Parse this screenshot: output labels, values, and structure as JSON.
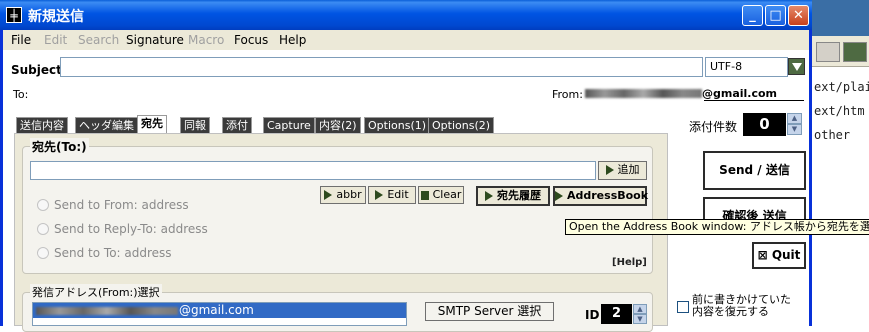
{
  "window": {
    "title": "新規送信"
  },
  "menu": [
    {
      "label": "File",
      "disabled": false
    },
    {
      "label": "Edit",
      "disabled": true
    },
    {
      "label": "Search",
      "disabled": true
    },
    {
      "label": "Signature",
      "disabled": false
    },
    {
      "label": "Macro",
      "disabled": true
    },
    {
      "label": "Focus",
      "disabled": false
    },
    {
      "label": "Help",
      "disabled": false
    }
  ],
  "compose": {
    "subject_label": "Subject",
    "subject_value": "",
    "encoding": "UTF-8",
    "to_label": "To:",
    "from_label": "From:",
    "from_domain": "@gmail.com"
  },
  "tabs": [
    "送信内容",
    "ヘッダ編集",
    "宛先",
    "同報",
    "添付",
    "Capture",
    "内容(2)",
    "Options(1)",
    "Options(2)"
  ],
  "active_tab": "宛先",
  "recipient": {
    "group_label": "宛先(To:)",
    "add_button": "追加",
    "abbr_button": "abbr",
    "edit_button": "Edit",
    "clear_button": "Clear",
    "history_button": "宛先履歴",
    "addressbook_button": "AddressBook",
    "options": [
      "Send to From: address",
      "Send to Reply-To: address",
      "Send to To: address"
    ],
    "help_link": "[Help]"
  },
  "from_section": {
    "label": "発信アドレス(From:)選択",
    "address_domain": "@gmail.com",
    "smtp_button": "SMTP Server 選択",
    "id_label": "ID",
    "id_value": "2"
  },
  "side": {
    "attach_label": "添付件数",
    "attach_count": "0",
    "send_button": "Send / 送信",
    "confirm_send_button": "確認後 送信",
    "quit_button": "Quit",
    "restore_label_line1": "前に書きかけていた",
    "restore_label_line2": "内容を復元する"
  },
  "tooltip": "Open the Address Book window: アドレス帳から宛先を選択",
  "background_window": {
    "lines": [
      "ext/plai",
      "ext/htm",
      "other"
    ]
  },
  "colors": {
    "titlebar": "#0054e3",
    "window_border": "#0831d9",
    "tab_dark": "#3b3b3b",
    "button_green": "#2d4a1e"
  }
}
